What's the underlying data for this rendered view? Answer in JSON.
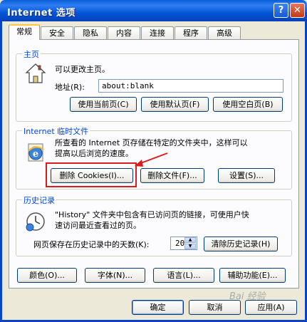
{
  "window": {
    "title": "Internet 选项",
    "help_glyph": "?",
    "close_glyph": "✕"
  },
  "tabs": [
    {
      "label": "常规",
      "active": true
    },
    {
      "label": "安全"
    },
    {
      "label": "隐私"
    },
    {
      "label": "内容"
    },
    {
      "label": "连接"
    },
    {
      "label": "程序"
    },
    {
      "label": "高级"
    }
  ],
  "homepage": {
    "legend": "主页",
    "description": "可以更改主页。",
    "address_label": "地址(R):",
    "address_value": "about:blank",
    "buttons": {
      "current": "使用当前页(C)",
      "default": "使用默认页(F)",
      "blank": "使用空白页(B)"
    }
  },
  "temp_files": {
    "legend": "Internet 临时文件",
    "description_line1": "所查看的 Internet 页存储在特定的文件夹中，这样可以",
    "description_line2": "提高以后浏览的速度。",
    "buttons": {
      "delete_cookies": "删除 Cookies(I)...",
      "delete_files": "删除文件(F)...",
      "settings": "设置(S)..."
    }
  },
  "history": {
    "legend": "历史记录",
    "description_line1": "\"History\" 文件夹中包含有已访问页的链接，可使用户快",
    "description_line2": "速访问最近查看过的页。",
    "days_label": "网页保存在历史记录中的天数(K):",
    "days_value": "20",
    "clear_button": "清除历史记录(H)"
  },
  "bottom_buttons": {
    "colors": "颜色(O)...",
    "fonts": "字体(N)...",
    "languages": "语言(L)...",
    "accessibility": "辅助功能(E)..."
  },
  "dialog_buttons": {
    "ok": "确定",
    "cancel": "取消",
    "apply": "应用(A)"
  },
  "watermark": "Bai 经验"
}
